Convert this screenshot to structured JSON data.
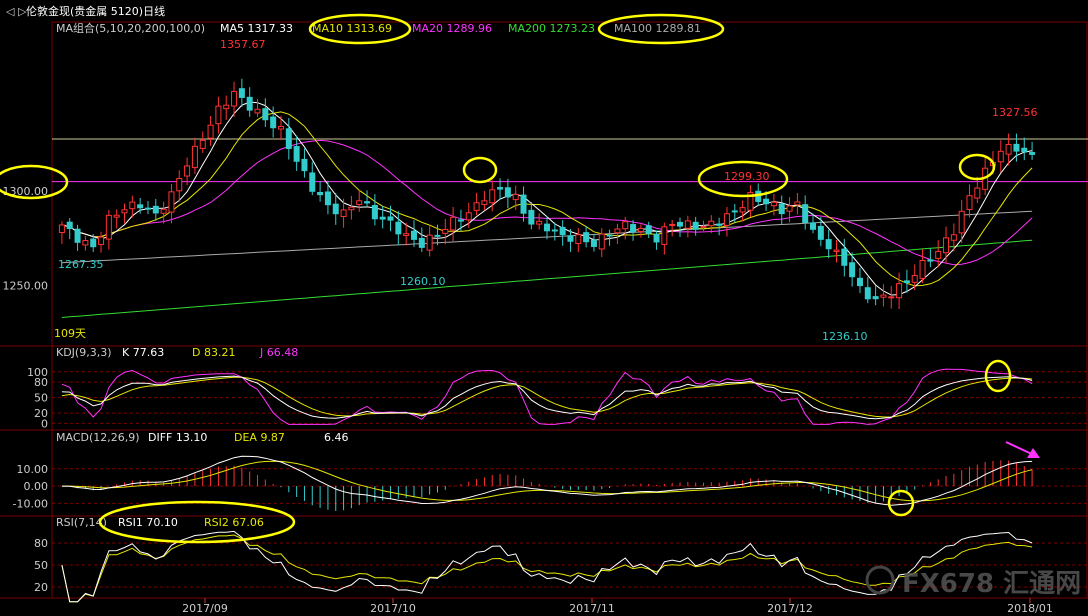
{
  "window_title": "伦敦金现(贵金属 5120)日线",
  "ma_header": {
    "label": "MA组合(5,10,20,200,100,0)",
    "items": [
      {
        "text": "MA5 1317.33",
        "color": "#ffffff"
      },
      {
        "text": "MA10 1313.69",
        "color": "#e6e600"
      },
      {
        "text": "MA20 1289.96",
        "color": "#ff33ff"
      },
      {
        "text": "MA200 1273.23",
        "color": "#33dd33"
      },
      {
        "text": "MA100 1289.81",
        "color": "#aaaaaa"
      }
    ]
  },
  "kdj_header": {
    "label": "KDJ(9,3,3)",
    "items": [
      {
        "text": "K   77.63",
        "color": "#ffffff"
      },
      {
        "text": "D   83.21",
        "color": "#e6e600"
      },
      {
        "text": "J   66.48",
        "color": "#ff33ff"
      }
    ]
  },
  "macd_header": {
    "label": "MACD(12,26,9)",
    "items": [
      {
        "text": "DIFF   13.10",
        "color": "#ffffff"
      },
      {
        "text": "DEA   9.87",
        "color": "#e6e600"
      },
      {
        "text": "6.46",
        "color": "#ffffff"
      }
    ]
  },
  "rsi_header": {
    "label": "RSI(7,14)",
    "items": [
      {
        "text": "RSI1   70.10",
        "color": "#ffffff"
      },
      {
        "text": "RSI2   67.06",
        "color": "#e6e600"
      }
    ]
  },
  "watermark": "FX678 汇通网",
  "colors": {
    "up": "#ff3232",
    "down": "#33cccc",
    "grid": "#7a0000",
    "axis_text": "#cccccc",
    "highlight": "#ffff00",
    "arrow": "#ff33ff"
  },
  "chart_data": {
    "type": "candlestick",
    "title": "伦敦金现(贵金属 5120)日线",
    "days_label": "109天",
    "x_ticks": [
      "2017/09",
      "2017/10",
      "2017/11",
      "2017/12",
      "2018/01"
    ],
    "price_axis": {
      "ticks": [
        1300,
        1250
      ],
      "tick_labels": [
        "1300.00",
        "1250.00"
      ],
      "range": [
        1220,
        1380
      ]
    },
    "annotations": [
      {
        "text": "1357.67",
        "price": 1357.67
      },
      {
        "text": "1267.35",
        "price": 1267.35
      },
      {
        "text": "1260.10",
        "price": 1260.1
      },
      {
        "text": "1299.30",
        "price": 1299.3
      },
      {
        "text": "1236.10",
        "price": 1236.1
      },
      {
        "text": "1327.56",
        "price": 1327.56
      }
    ],
    "reference_lines": [
      1327.56,
      1305
    ],
    "kdj_axis": {
      "ticks": [
        100,
        80,
        50,
        20,
        0
      ],
      "tick_labels": [
        "100",
        "80",
        "50",
        "20",
        "0"
      ],
      "range": [
        -5,
        115
      ]
    },
    "macd_axis": {
      "ticks": [
        10,
        0,
        -10
      ],
      "tick_labels": [
        "10.00",
        "0.00",
        "-10.00"
      ],
      "range": [
        -15,
        22
      ]
    },
    "rsi_axis": {
      "ticks": [
        80,
        50,
        20
      ],
      "tick_labels": [
        "80",
        "50",
        "20"
      ],
      "range": [
        5,
        95
      ]
    },
    "price_anchors": [
      1282,
      1275,
      1270,
      1285,
      1291,
      1293,
      1287,
      1298,
      1315,
      1328,
      1343,
      1352,
      1345,
      1338,
      1332,
      1316,
      1302,
      1292,
      1288,
      1296,
      1287,
      1283,
      1276,
      1272,
      1277,
      1284,
      1288,
      1297,
      1301,
      1296,
      1283,
      1281,
      1276,
      1275,
      1272,
      1278,
      1282,
      1279,
      1275,
      1283,
      1282,
      1281,
      1284,
      1289,
      1297,
      1294,
      1290,
      1293,
      1278,
      1271,
      1262,
      1248,
      1242,
      1246,
      1252,
      1261,
      1268,
      1279,
      1297,
      1310,
      1322,
      1323,
      1318
    ]
  }
}
